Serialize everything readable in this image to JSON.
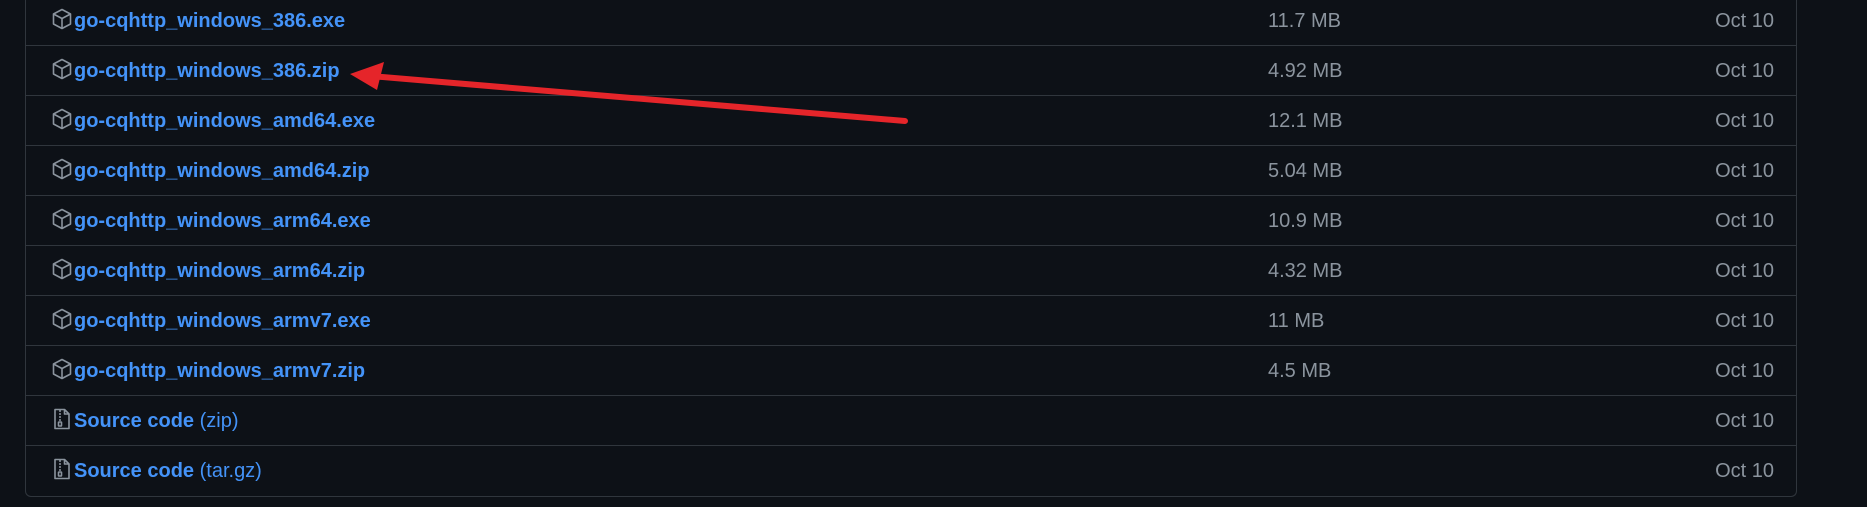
{
  "assets": [
    {
      "name": "go-cqhttp_windows_386.exe",
      "suffix": "",
      "size": "11.7 MB",
      "date": "Oct 10",
      "icon": "package-icon"
    },
    {
      "name": "go-cqhttp_windows_386.zip",
      "suffix": "",
      "size": "4.92 MB",
      "date": "Oct 10",
      "icon": "package-icon"
    },
    {
      "name": "go-cqhttp_windows_amd64.exe",
      "suffix": "",
      "size": "12.1 MB",
      "date": "Oct 10",
      "icon": "package-icon"
    },
    {
      "name": "go-cqhttp_windows_amd64.zip",
      "suffix": "",
      "size": "5.04 MB",
      "date": "Oct 10",
      "icon": "package-icon"
    },
    {
      "name": "go-cqhttp_windows_arm64.exe",
      "suffix": "",
      "size": "10.9 MB",
      "date": "Oct 10",
      "icon": "package-icon"
    },
    {
      "name": "go-cqhttp_windows_arm64.zip",
      "suffix": "",
      "size": "4.32 MB",
      "date": "Oct 10",
      "icon": "package-icon"
    },
    {
      "name": "go-cqhttp_windows_armv7.exe",
      "suffix": "",
      "size": "11 MB",
      "date": "Oct 10",
      "icon": "package-icon"
    },
    {
      "name": "go-cqhttp_windows_armv7.zip",
      "suffix": "",
      "size": "4.5 MB",
      "date": "Oct 10",
      "icon": "package-icon"
    },
    {
      "name": "Source code",
      "suffix": "(zip)",
      "size": "",
      "date": "Oct 10",
      "icon": "file-zip-icon"
    },
    {
      "name": "Source code",
      "suffix": "(tar.gz)",
      "size": "",
      "date": "Oct 10",
      "icon": "file-zip-icon"
    }
  ],
  "annotation": {
    "type": "red-arrow",
    "color": "#e5252a",
    "points_to": "go-cqhttp_windows_386.zip"
  },
  "colors": {
    "background": "#0d1117",
    "border": "#30363d",
    "link": "#4493f8",
    "muted": "#8b949e",
    "icon": "#8b949e"
  }
}
